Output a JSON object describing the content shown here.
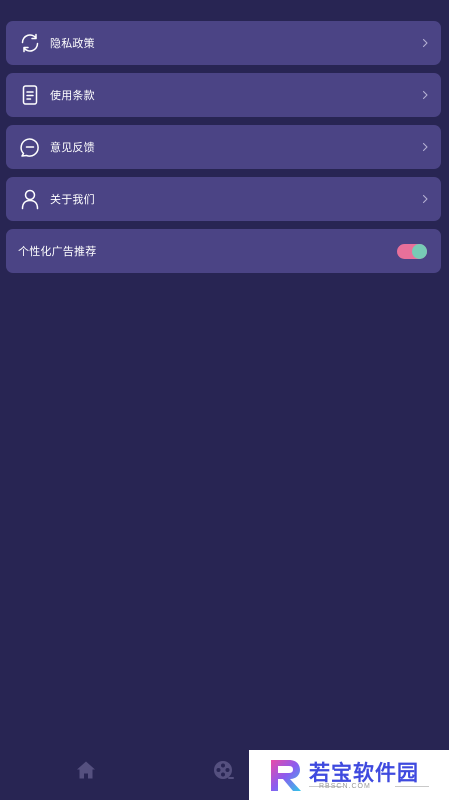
{
  "menu": {
    "items": [
      {
        "label": "隐私政策",
        "icon": "sync-icon"
      },
      {
        "label": "使用条款",
        "icon": "document-icon"
      },
      {
        "label": "意见反馈",
        "icon": "feedback-chat-icon"
      },
      {
        "label": "关于我们",
        "icon": "person-icon"
      }
    ],
    "toggle_row": {
      "label": "个性化广告推荐",
      "enabled": true
    }
  },
  "tabbar": {
    "tabs": [
      {
        "icon": "home-icon"
      },
      {
        "icon": "film-reel-icon"
      }
    ]
  },
  "watermark": {
    "title": "若宝软件园",
    "subtitle": "RBSCN.COM"
  },
  "colors": {
    "background": "#282553",
    "card": "#4b4485",
    "toggle_track": "#e8709a",
    "toggle_knob": "#77cbb6",
    "tab_icon": "#55507f"
  }
}
